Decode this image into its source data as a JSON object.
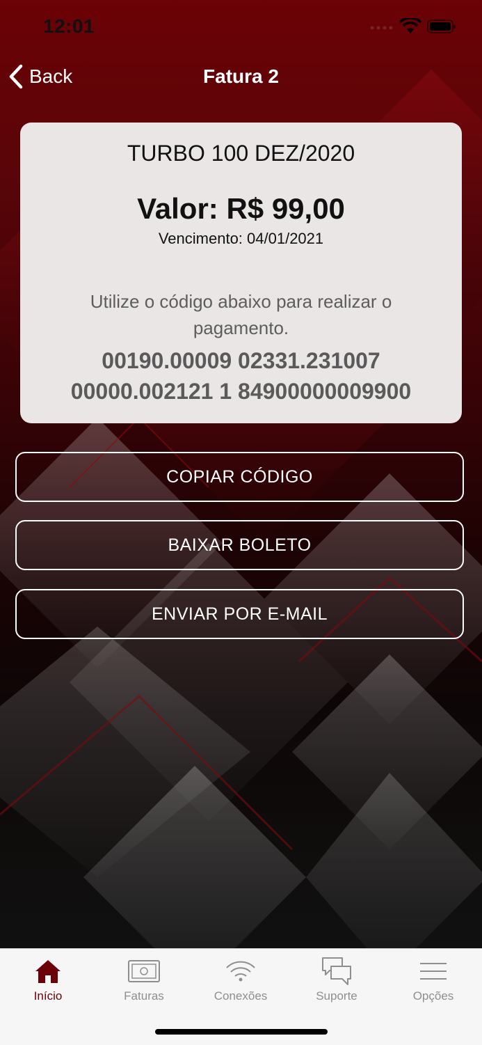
{
  "status_bar": {
    "time": "12:01"
  },
  "nav": {
    "back_label": "Back",
    "title": "Fatura 2"
  },
  "invoice": {
    "plan": "TURBO 100 DEZ/2020",
    "amount": "Valor: R$ 99,00",
    "due": "Vencimento: 04/01/2021",
    "instruction": "Utilize o código abaixo para realizar o pagamento.",
    "code": "00190.00009 02331.231007 00000.002121 1 84900000009900"
  },
  "actions": {
    "copy": "COPIAR CÓDIGO",
    "download": "BAIXAR BOLETO",
    "email": "ENVIAR POR E-MAIL"
  },
  "tabs": [
    {
      "label": "Início",
      "icon": "home-icon",
      "active": true
    },
    {
      "label": "Faturas",
      "icon": "invoice-icon",
      "active": false
    },
    {
      "label": "Conexões",
      "icon": "wifi-icon",
      "active": false
    },
    {
      "label": "Suporte",
      "icon": "chat-icon",
      "active": false
    },
    {
      "label": "Opções",
      "icon": "menu-icon",
      "active": false
    }
  ],
  "colors": {
    "accent": "#6b0008",
    "card": "#ebe6e6",
    "tab_inactive": "#8e8e8e"
  }
}
